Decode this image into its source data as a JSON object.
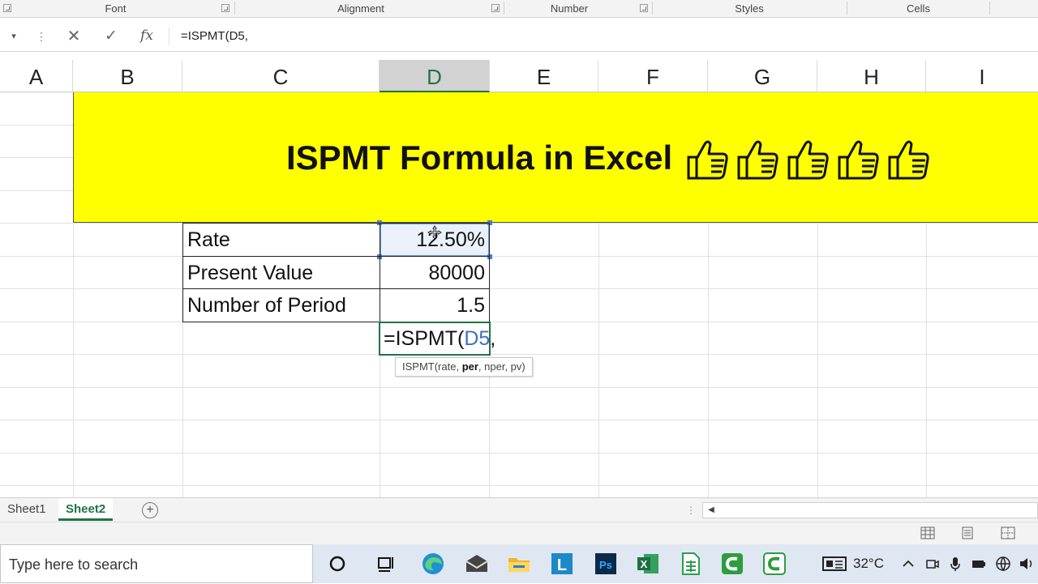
{
  "ribbon": {
    "groups": [
      "Font",
      "Alignment",
      "Number",
      "Styles",
      "Cells"
    ]
  },
  "formula_bar": {
    "name_box_arrow": "▾",
    "dots": "⋮",
    "cancel": "✕",
    "enter": "✓",
    "fx": "fx",
    "content": "=ISPMT(D5,"
  },
  "columns": [
    "A",
    "B",
    "C",
    "D",
    "E",
    "F",
    "G",
    "H",
    "I"
  ],
  "selected_column": "D",
  "banner": {
    "title": "ISPMT Formula in Excel",
    "thumbs_count": 5,
    "background": "#ffff00"
  },
  "table": {
    "rows": [
      {
        "label": "Rate",
        "value": "12.50%"
      },
      {
        "label": "Present Value",
        "value": "80000"
      },
      {
        "label": "Number of Period",
        "value": "1.5"
      }
    ]
  },
  "editing_cell": {
    "prefix": "=ISPMT(",
    "ref": "D5",
    "suffix": ","
  },
  "tooltip": {
    "fn": "ISPMT(rate, ",
    "bold_arg": "per",
    "rest": ", nper, pv)"
  },
  "sheets": {
    "tabs": [
      "Sheet1",
      "Sheet2"
    ],
    "active": "Sheet2",
    "add": "+"
  },
  "taskbar": {
    "search_placeholder": "Type here to search",
    "temperature": "32°C"
  },
  "colors": {
    "excel_green": "#217346",
    "ref_blue": "#3d6fc4",
    "selection_blue": "#6a9ad8"
  }
}
